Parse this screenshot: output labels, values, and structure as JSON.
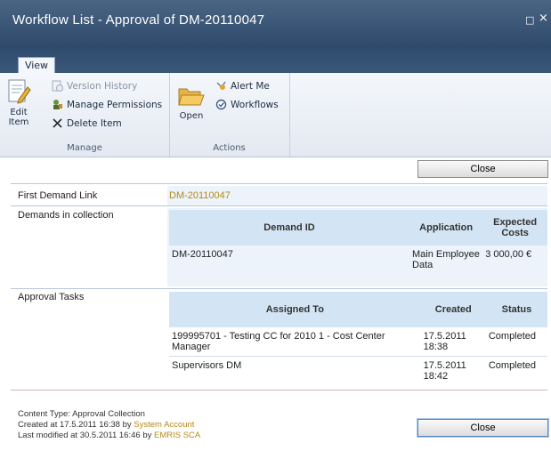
{
  "window": {
    "title": "Workflow List - Approval of DM-20110047",
    "maximize_glyph": "□",
    "close_glyph": "×"
  },
  "ribbon": {
    "tab_label": "View",
    "manage": {
      "edit_item_line1": "Edit",
      "edit_item_line2": "Item",
      "version_history": "Version History",
      "manage_permissions": "Manage Permissions",
      "delete_item": "Delete Item",
      "group_label": "Manage"
    },
    "actions": {
      "open": "Open",
      "alert_me": "Alert Me",
      "workflows": "Workflows",
      "group_label": "Actions"
    }
  },
  "form": {
    "close_label": "Close",
    "first_demand_link_label": "First Demand Link",
    "first_demand_link_value": "DM-20110047",
    "demands_label": "Demands in collection",
    "demands_table": {
      "headers": [
        "Demand ID",
        "Application",
        "Expected Costs"
      ],
      "rows": [
        {
          "demand_id": "DM-20110047",
          "application": "Main Employee Data",
          "expected_costs": "3 000,00 €"
        }
      ]
    },
    "approval_tasks_label": "Approval Tasks",
    "tasks_table": {
      "headers": [
        "Assigned To",
        "Created",
        "Status"
      ],
      "rows": [
        {
          "assigned_to": "199995701 - Testing CC for 2010 1 - Cost Center Manager",
          "created": "17.5.2011 18:38",
          "status": "Completed"
        },
        {
          "assigned_to": "Supervisors DM",
          "created": "17.5.2011 18:42",
          "status": "Completed"
        }
      ]
    }
  },
  "footer": {
    "content_type": "Content Type: Approval Collection",
    "created_prefix": "Created at 17.5.2011 16:38 by ",
    "created_by": "System Account",
    "modified_prefix": "Last modified at 30.5.2011 16:46 by ",
    "modified_by": "EMRIS SCA"
  },
  "colors": {
    "titlebar": "#3b5676",
    "link": "#b68a18",
    "header_fill": "#d3e5f4",
    "value_fill": "#ecf3fa"
  },
  "icons": [
    "edit-item-icon",
    "version-history-icon",
    "manage-permissions-icon",
    "delete-icon",
    "open-folder-icon",
    "alert-me-icon",
    "workflows-icon"
  ]
}
